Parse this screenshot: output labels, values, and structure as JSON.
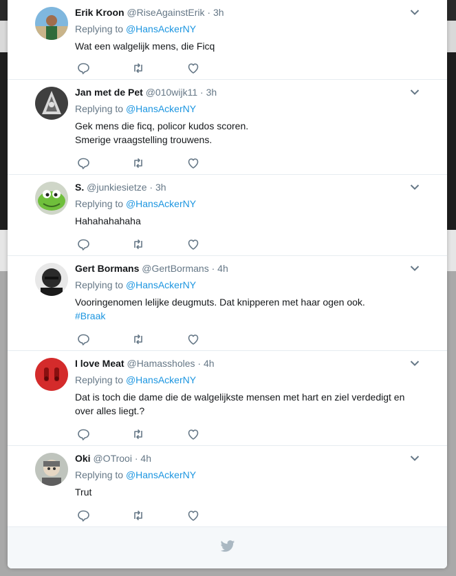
{
  "tweets": [
    {
      "name": "Erik Kroon",
      "handle": "@RiseAgainstErik",
      "time": "3h",
      "replying_label": "Replying to",
      "replying_to": "@HansAckerNY",
      "lines": [
        "Wat een walgelijk mens, die Ficq"
      ],
      "hashtag": ""
    },
    {
      "name": "Jan met de Pet",
      "handle": "@010wijk11",
      "time": "3h",
      "replying_label": "Replying to",
      "replying_to": "@HansAckerNY",
      "lines": [
        "Gek mens die ficq, policor kudos scoren.",
        "Smerige vraagstelling trouwens."
      ],
      "hashtag": ""
    },
    {
      "name": "S.",
      "handle": "@junkiesietze",
      "time": "3h",
      "replying_label": "Replying to",
      "replying_to": "@HansAckerNY",
      "lines": [
        "Hahahahahaha"
      ],
      "hashtag": ""
    },
    {
      "name": "Gert Bormans",
      "handle": "@GertBormans",
      "time": "4h",
      "replying_label": "Replying to",
      "replying_to": "@HansAckerNY",
      "lines": [
        "Vooringenomen lelijke deugmuts. Dat knipperen met haar ogen ook."
      ],
      "hashtag": "#Braak"
    },
    {
      "name": "I love Meat",
      "handle": "@Hamassholes",
      "time": "4h",
      "replying_label": "Replying to",
      "replying_to": "@HansAckerNY",
      "lines": [
        "Dat is toch die dame die de walgelijkste mensen met hart en ziel verdedigt en",
        "over alles liegt.?"
      ],
      "hashtag": ""
    },
    {
      "name": "Oki",
      "handle": "@OTrooi",
      "time": "4h",
      "replying_label": "Replying to",
      "replying_to": "@HansAckerNY",
      "lines": [
        "Trut"
      ],
      "hashtag": ""
    }
  ],
  "icons": {
    "reply": "reply-icon",
    "retweet": "retweet-icon",
    "like": "heart-icon",
    "more": "chevron-down-icon",
    "brand": "twitter-bird-icon"
  },
  "colors": {
    "text": "#14171a",
    "muted": "#657786",
    "link": "#1b95e0",
    "icon": "#657786",
    "divider": "#e6ecf0",
    "footer": "#f5f8fa"
  }
}
